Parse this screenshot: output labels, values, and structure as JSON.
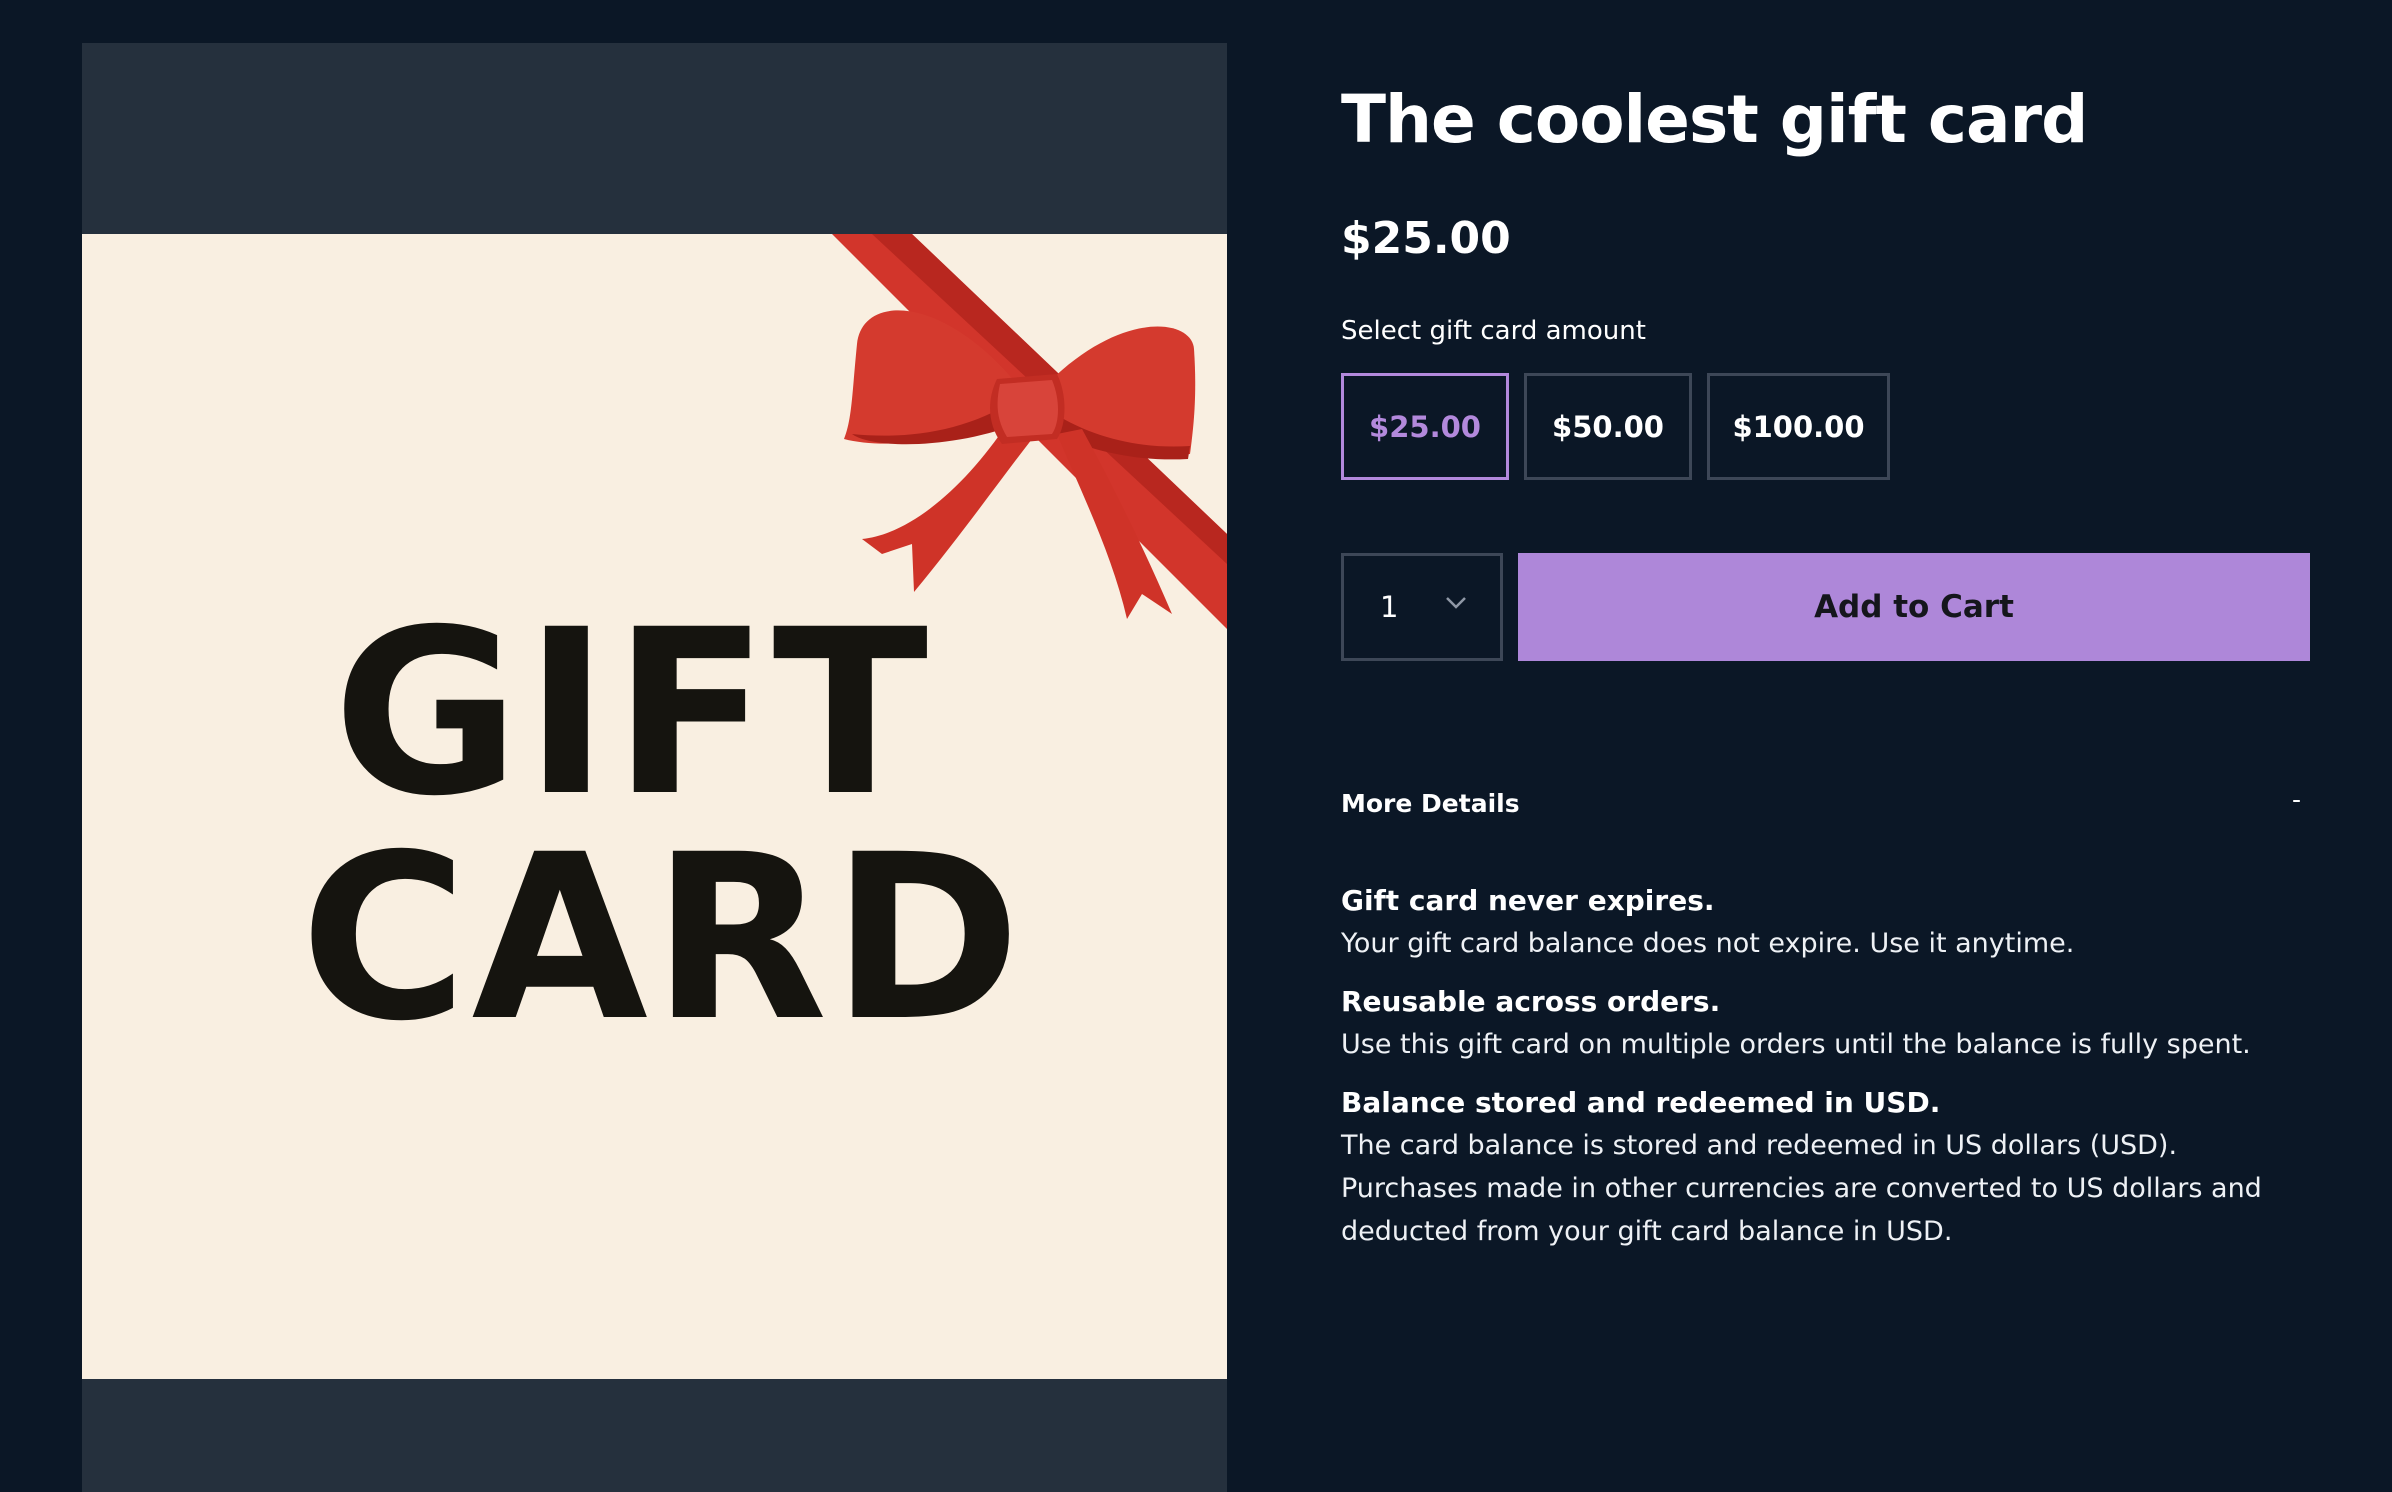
{
  "product": {
    "title": "The coolest gift card",
    "price": "$25.00",
    "image": {
      "line1": "GIFT",
      "line2": "CARD"
    }
  },
  "amount_selector": {
    "label": "Select gift card amount",
    "options": [
      "$25.00",
      "$50.00",
      "$100.00"
    ],
    "selected": "$25.00"
  },
  "quantity": {
    "value": "1"
  },
  "cart": {
    "add_label": "Add to Cart"
  },
  "more_details": {
    "label": "More Details",
    "toggle": "-",
    "items": [
      {
        "heading": "Gift card never expires.",
        "text": "Your gift card balance does not expire. Use it anytime."
      },
      {
        "heading": "Reusable across orders.",
        "text": "Use this gift card on multiple orders until the balance is fully spent."
      },
      {
        "heading": "Balance stored and redeemed in USD.",
        "text": "The card balance is stored and redeemed in US dollars (USD). Purchases made in other currencies are converted to US dollars and deducted from your gift card balance in USD."
      }
    ]
  },
  "colors": {
    "background": "#0b1726",
    "image_frame": "#25303d",
    "card_bg": "#f9efe1",
    "accent": "#ae87d9",
    "selected_text": "#b389dc",
    "ribbon": "#d2352b"
  }
}
